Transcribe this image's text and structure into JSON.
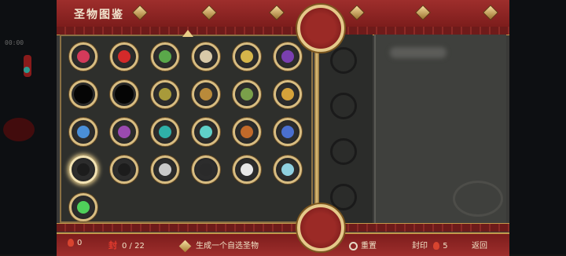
{
  "left_hud": {
    "timer": "00:00"
  },
  "header": {
    "title": "圣物图鉴"
  },
  "relics": [
    {
      "color": "#d33a5a"
    },
    {
      "color": "#d42a2a"
    },
    {
      "color": "#5aa84a"
    },
    {
      "color": "#d8c9a8"
    },
    {
      "color": "#d5b54a"
    },
    {
      "color": "#7a3fb0"
    },
    {
      "color": "locked"
    },
    {
      "color": "locked"
    },
    {
      "color": "#a89a3a"
    },
    {
      "color": "#b98a3a"
    },
    {
      "color": "#7aa04a"
    },
    {
      "color": "#d5a23a"
    },
    {
      "color": "#4a8fd8"
    },
    {
      "color": "#9b4ab0"
    },
    {
      "color": "#2fb0a8"
    },
    {
      "color": "#5fd0c8"
    },
    {
      "color": "#c26a2a"
    },
    {
      "color": "#4a6fd0"
    },
    {
      "color": "#1c1c1c"
    },
    {
      "color": "#1c1c1c"
    },
    {
      "color": "#c9c9c9"
    },
    {
      "color": "#2a2a2a"
    },
    {
      "color": "#e8e8e8"
    },
    {
      "color": "#8fd0e0"
    },
    {
      "color": "#4fd05a"
    }
  ],
  "footer": {
    "flame_count": "0",
    "seal_glyph": "封",
    "seal_count": "0 / 22",
    "generate_label": "生成一个自选圣物",
    "reset_label": "重置",
    "seal_label": "封印",
    "seal_value": "5",
    "back_label": "返回"
  }
}
